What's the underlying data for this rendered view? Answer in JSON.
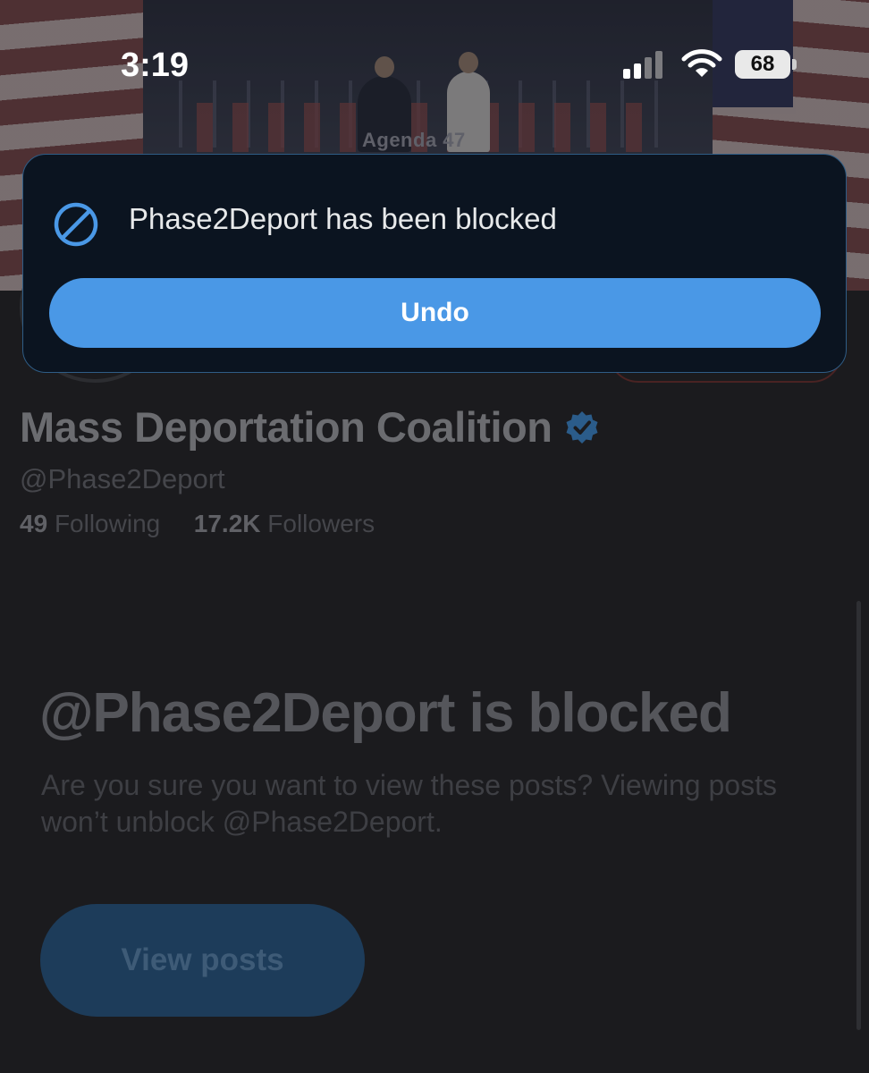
{
  "status_bar": {
    "time": "3:19",
    "battery": "68"
  },
  "banner": {
    "stage_text": "Agenda 47"
  },
  "toast": {
    "message": "Phase2Deport has been blocked",
    "undo_label": "Undo",
    "icon": "block-icon",
    "accent": "#4a98e6"
  },
  "profile": {
    "display_name": "Mass Deportation Coalition",
    "verified_icon": "verified-badge-icon",
    "handle": "@Phase2Deport",
    "following_count": "49",
    "following_label": "Following",
    "followers_count": "17.2K",
    "followers_label": "Followers"
  },
  "blocked_notice": {
    "title": "@Phase2Deport is blocked",
    "description": "Are you sure you want to view these posts? Viewing posts won’t unblock @Phase2Deport.",
    "button_label": "View posts"
  }
}
